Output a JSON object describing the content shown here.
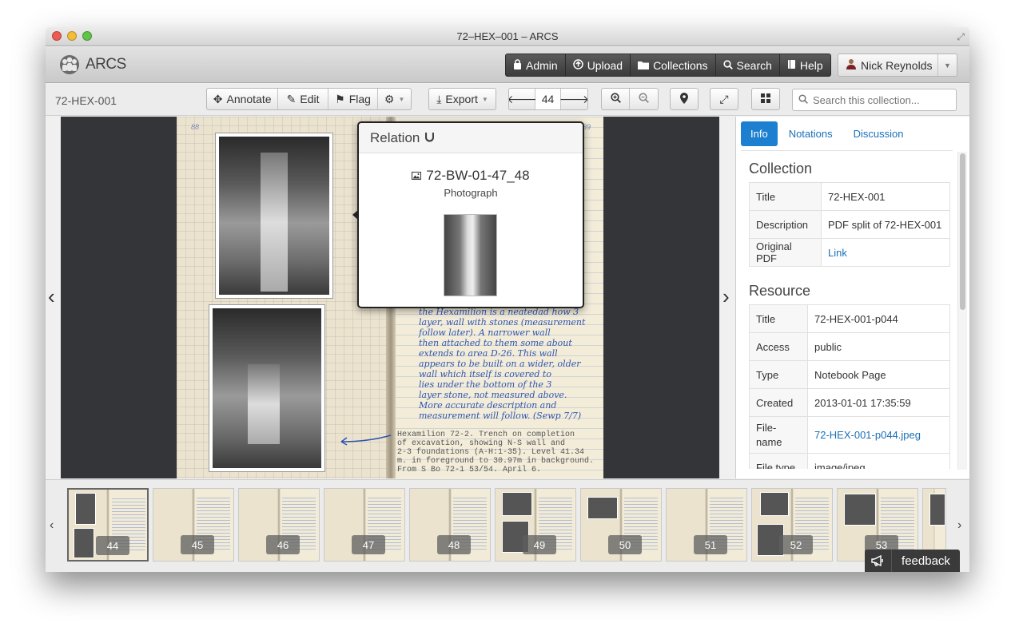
{
  "window": {
    "title": "72–HEX–001 – ARCS"
  },
  "navbar": {
    "logo_text": "ARCS",
    "items": [
      {
        "label": "Admin",
        "icon": "lock-icon"
      },
      {
        "label": "Upload",
        "icon": "upload-icon"
      },
      {
        "label": "Collections",
        "icon": "folder-icon"
      },
      {
        "label": "Search",
        "icon": "search-icon"
      },
      {
        "label": "Help",
        "icon": "book-icon"
      }
    ],
    "user": "Nick Reynolds"
  },
  "toolbar": {
    "page_id": "72-HEX-001",
    "annotate": "Annotate",
    "edit": "Edit",
    "flag": "Flag",
    "export": "Export",
    "page_number": "44",
    "search_placeholder": "Search this collection..."
  },
  "viewer": {
    "left_page_number": "88",
    "right_page_number": "89",
    "handwriting_lines": [
      "the Hexamilion is a neatedad how 3",
      "layer, wall with stones (measurement",
      "follow later). A narrower wall",
      "then attached to them some about",
      "extends to area D-26. This wall",
      "appears to be built on a wider, older",
      "wall which itself is covered to",
      "lies under the bottom of the 3",
      "layer stone, not measured above.",
      "More accurate description and",
      "measurement will follow. (Sewp 7/7)"
    ],
    "typed_caption": [
      "Hexamilion 72-2. Trench on completion",
      "of excavation, showing N-S wall and",
      "2-3 foundations (A-H:1-35). Level 41.34",
      "m. in foreground to 30.97m in background.",
      "From S Bo 72-1 53/54. April 6."
    ]
  },
  "relation_popover": {
    "header": "Relation",
    "title": "72-BW-01-47_48",
    "type": "Photograph"
  },
  "sidebar": {
    "tabs": [
      "Info",
      "Notations",
      "Discussion"
    ],
    "collection": {
      "heading": "Collection",
      "rows": [
        {
          "key": "Title",
          "value": "72-HEX-001"
        },
        {
          "key": "Description",
          "value": "PDF split of 72-HEX-001"
        },
        {
          "key": "Original PDF",
          "value": "Link"
        }
      ]
    },
    "resource": {
      "heading": "Resource",
      "rows": [
        {
          "key": "Title",
          "value": "72-HEX-001-p044"
        },
        {
          "key": "Access",
          "value": "public"
        },
        {
          "key": "Type",
          "value": "Notebook Page"
        },
        {
          "key": "Created",
          "value": "2013-01-01 17:35:59"
        },
        {
          "key": "File-name",
          "value": "72-HEX-001-p044.jpeg"
        },
        {
          "key": "File type",
          "value": "image/jpeg"
        }
      ]
    }
  },
  "filmstrip": {
    "pages": [
      "44",
      "45",
      "46",
      "47",
      "48",
      "49",
      "50",
      "51",
      "52",
      "53"
    ],
    "active": "44"
  },
  "feedback": {
    "label": "feedback"
  },
  "colors": {
    "accent": "#1d7fcf",
    "nav_dark": "#3b3b3b",
    "link": "#1a6fb8"
  }
}
